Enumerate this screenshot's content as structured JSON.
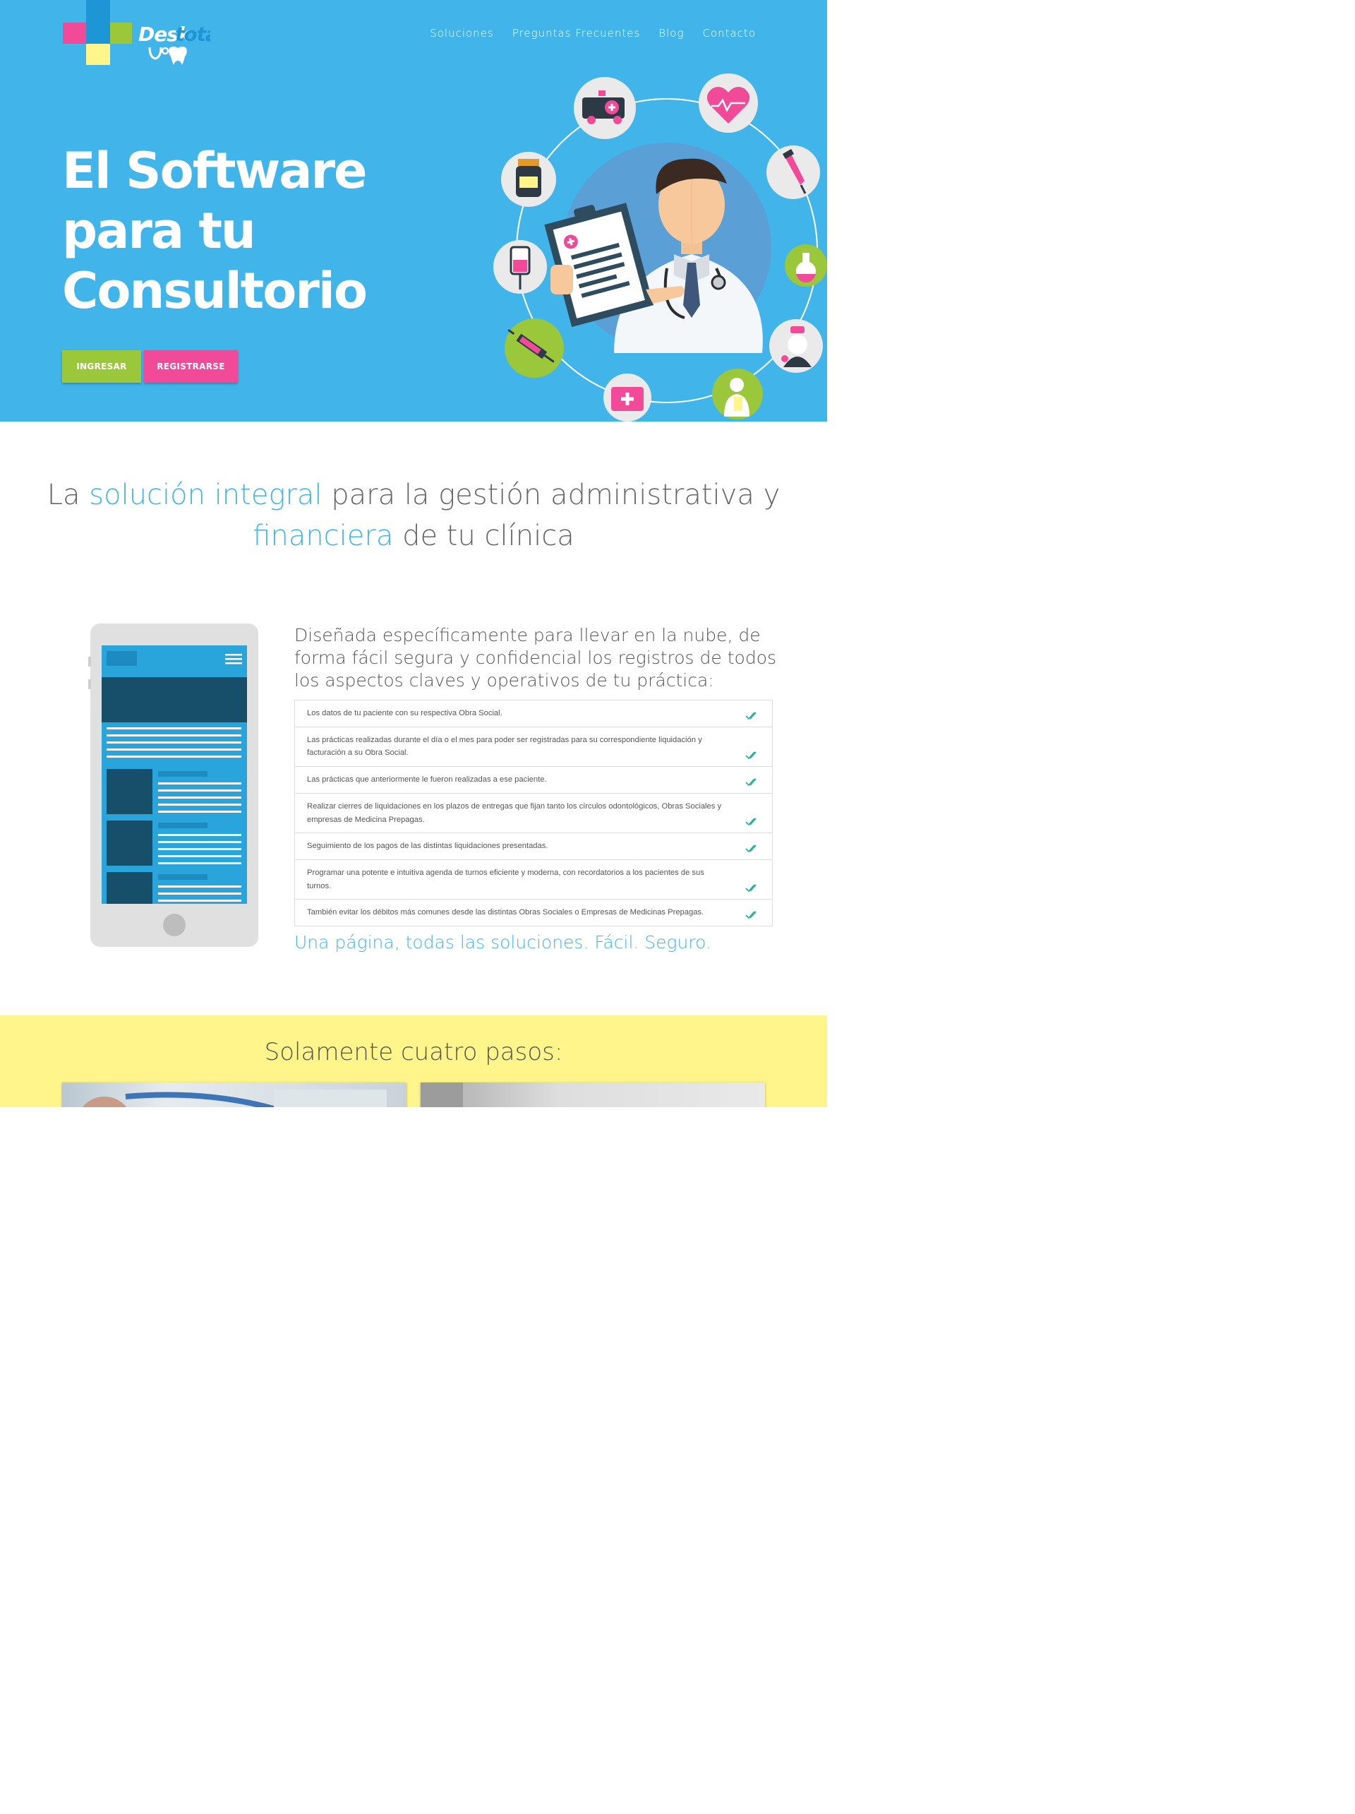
{
  "brand": {
    "name_part1": "Desk",
    "name_part2": "total",
    "colors": {
      "blue": "#1e96d6",
      "pink": "#f04a98",
      "green": "#9bc73a",
      "yellow": "#fff58a"
    }
  },
  "nav": {
    "items": [
      {
        "label": "Soluciones"
      },
      {
        "label": "Preguntas Frecuentes"
      },
      {
        "label": "Blog"
      },
      {
        "label": "Contacto"
      }
    ]
  },
  "hero": {
    "title_line1": "El Software",
    "title_line2": "para tu",
    "title_line3": "Consultorio",
    "btn_ingresar": "INGRESAR",
    "btn_registrarse": "REGISTRARSE",
    "background": "#41b5ea"
  },
  "intro": {
    "p1": "La ",
    "h1": "solución integral",
    "p2": " para la gestión administrativa y ",
    "h2": "financiera",
    "p3": " de tu clínica"
  },
  "features": {
    "heading": "Diseñada específicamente para llevar en la nube, de forma fácil segura y confidencial los registros de todos los aspectos claves y operativos de tu práctica:",
    "items": [
      "Los datos de tu paciente con su respectiva Obra Social.",
      "Las prácticas realizadas durante el día o el mes para poder ser registradas para su correspondiente liquidación y facturación a su Obra Social.",
      "Las prácticas que anteriormente le fueron realizadas a ese paciente.",
      "Realizar cierres de liquidaciones en los plazos de entregas que fijan tanto los círculos odontológicos, Obras Sociales y empresas de Medicina Prepagas.",
      "Seguimiento de los pagos de las distintas liquidaciones presentadas.",
      "Programar una potente e intuitiva agenda de turnos eficiente y moderna, con recordatorios a los pacientes de sus turnos.",
      "También evitar los débitos más comunes desde las distintas Obras Sociales o Empresas de Medicinas Prepagas."
    ],
    "check_icon": "double-check-icon",
    "check_color": "#2bb3a0",
    "tagline": "Una página, todas las soluciones. Fácil. Seguro."
  },
  "steps": {
    "title": "Solamente cuatro pasos:"
  }
}
